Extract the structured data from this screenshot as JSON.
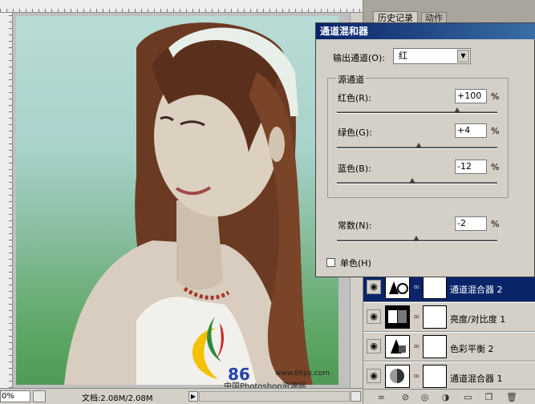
{
  "document": {
    "zoom": "0%",
    "doc_info": "文档:2.08M/2.08M",
    "scroll_arrow": "▶"
  },
  "watermark": {
    "number": "86",
    "site": "www.86ps.com",
    "caption": "中国Photoshop资源网"
  },
  "panel": {
    "tab_history": "历史记录",
    "tab_actions": "动作",
    "layers": [
      {
        "name": "通道混合器 2",
        "selected": true
      },
      {
        "name": "亮度/对比度 1",
        "selected": false
      },
      {
        "name": "色彩平衡 2",
        "selected": false
      },
      {
        "name": "通道混合器 1",
        "selected": false
      }
    ],
    "toolbar_icons": [
      "link-icon",
      "fx-icon",
      "mask-icon",
      "adjustment-icon",
      "folder-icon",
      "new-layer-icon",
      "trash-icon"
    ]
  },
  "dialog": {
    "title": "通道混和器",
    "output_label": "输出通道(O):",
    "output_value": "红",
    "source_group": "源通道",
    "channels": [
      {
        "label": "红色(R):",
        "value": "+100",
        "level": 100
      },
      {
        "label": "绿色(G):",
        "value": "+4",
        "level": 4
      },
      {
        "label": "蓝色(B):",
        "value": "-12",
        "level": -12
      }
    ],
    "constant": {
      "label": "常数(N):",
      "value": "-2",
      "level": -2
    },
    "percent": "%",
    "monochrome_label": "单色(H)",
    "monochrome_checked": false,
    "slider_range": [
      -200,
      200
    ]
  },
  "colors": {
    "title_bar": "#0a246a",
    "selection": "#0a246a",
    "watermark_blue": "#2244aa",
    "watermark_yellow": "#f2c200",
    "watermark_red": "#cc2222"
  }
}
